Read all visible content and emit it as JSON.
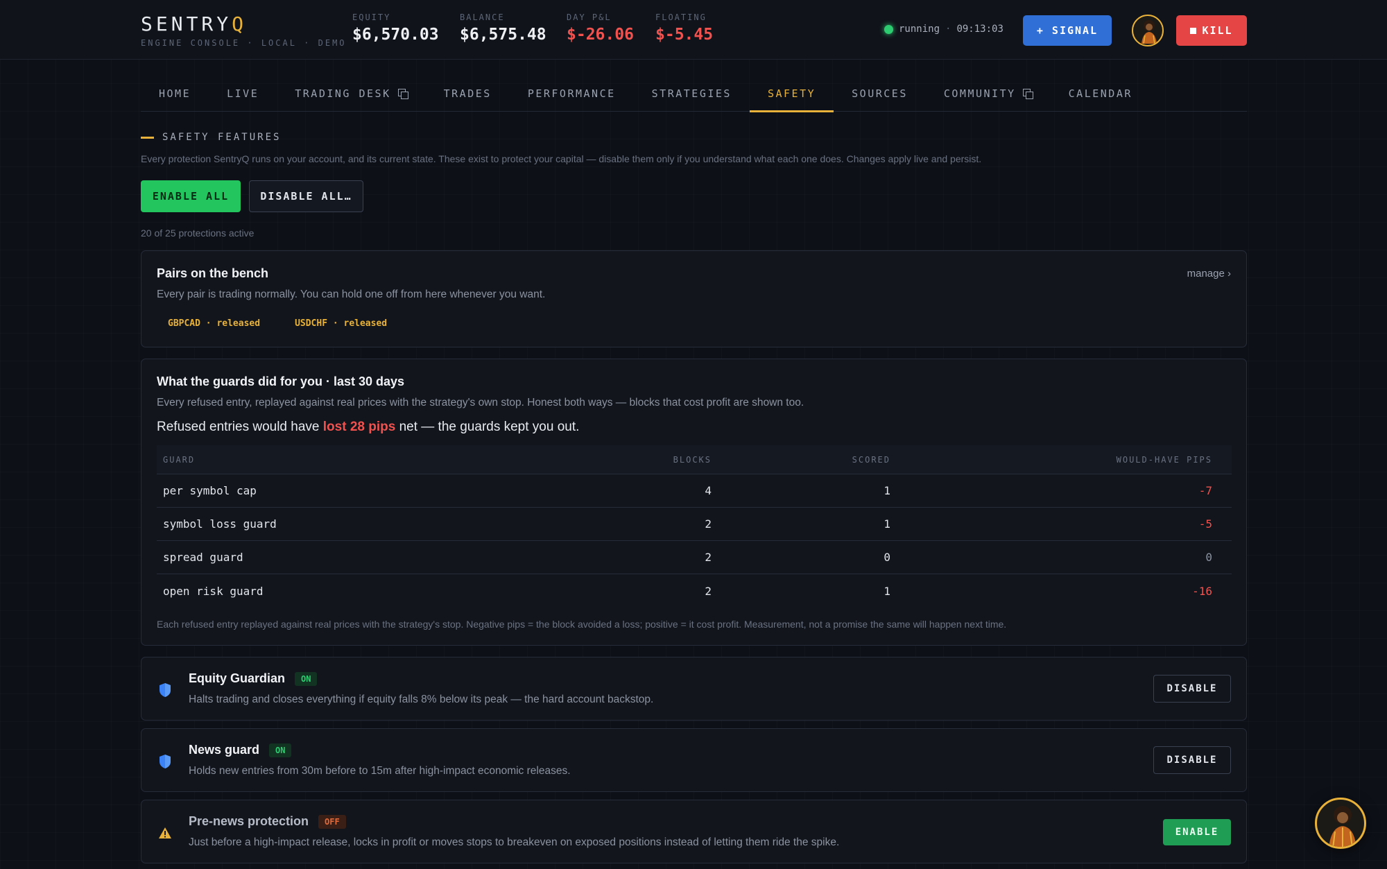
{
  "brand": {
    "name_main": "SENTRY",
    "name_accent": "Q",
    "subtitle": "ENGINE CONSOLE · LOCAL · DEMO"
  },
  "metrics": [
    {
      "label": "EQUITY",
      "value": "$6,570.03",
      "negative": false
    },
    {
      "label": "BALANCE",
      "value": "$6,575.48",
      "negative": false
    },
    {
      "label": "DAY P&L",
      "value": "$-26.06",
      "negative": true
    },
    {
      "label": "FLOATING",
      "value": "$-5.45",
      "negative": true
    }
  ],
  "status": {
    "state": "running",
    "separator": "·",
    "time": "09:13:03"
  },
  "buttons": {
    "signal": "+ SIGNAL",
    "kill": "KILL"
  },
  "nav": {
    "tabs": [
      {
        "label": "HOME"
      },
      {
        "label": "LIVE"
      },
      {
        "label": "TRADING DESK"
      },
      {
        "label": "TRADES"
      },
      {
        "label": "PERFORMANCE"
      },
      {
        "label": "STRATEGIES"
      },
      {
        "label": "SAFETY"
      },
      {
        "label": "SOURCES"
      },
      {
        "label": "COMMUNITY"
      },
      {
        "label": "CALENDAR"
      }
    ],
    "active": "SAFETY",
    "external": [
      "TRADING DESK",
      "COMMUNITY"
    ]
  },
  "safety": {
    "title": "SAFETY FEATURES",
    "description": "Every protection SentryQ runs on your account, and its current state. These exist to protect your capital — disable them only if you understand what each one does. Changes apply live and persist.",
    "enable_all": "ENABLE ALL",
    "disable_all": "DISABLE ALL…",
    "active_count": "20 of 25 protections active"
  },
  "bench": {
    "title": "Pairs on the bench",
    "subtitle": "Every pair is trading normally. You can hold one off from here whenever you want.",
    "manage": "manage ›",
    "chips": [
      "GBPCAD · released",
      "USDCHF · released"
    ]
  },
  "guards": {
    "title": "What the guards did for you · last 30 days",
    "subtitle": "Every refused entry, replayed against real prices with the strategy's own stop. Honest both ways — blocks that cost profit are shown too.",
    "summary_pre": "Refused entries would have ",
    "summary_hl": "lost 28 pips",
    "summary_post": " net — the guards kept you out.",
    "columns": [
      "GUARD",
      "BLOCKS",
      "SCORED",
      "WOULD-HAVE PIPS"
    ],
    "rows": [
      {
        "guard": "per symbol cap",
        "blocks": "4",
        "scored": "1",
        "pips": "-7"
      },
      {
        "guard": "symbol loss guard",
        "blocks": "2",
        "scored": "1",
        "pips": "-5"
      },
      {
        "guard": "spread guard",
        "blocks": "2",
        "scored": "0",
        "pips": "0"
      },
      {
        "guard": "open risk guard",
        "blocks": "2",
        "scored": "1",
        "pips": "-16"
      }
    ],
    "footnote": "Each refused entry replayed against real prices with the strategy's stop. Negative pips = the block avoided a loss; positive = it cost profit. Measurement, not a promise the same will happen next time."
  },
  "features": [
    {
      "title": "Equity Guardian",
      "badge": "ON",
      "state": "on",
      "icon": "shield-icon",
      "desc": "Halts trading and closes everything if equity falls 8% below its peak — the hard account backstop.",
      "action": "DISABLE"
    },
    {
      "title": "News guard",
      "badge": "ON",
      "state": "on",
      "icon": "shield-icon",
      "desc": "Holds new entries from 30m before to 15m after high-impact economic releases.",
      "action": "DISABLE"
    },
    {
      "title": "Pre-news protection",
      "badge": "OFF",
      "state": "off",
      "icon": "warning-icon",
      "desc": "Just before a high-impact release, locks in profit or moves stops to breakeven on exposed positions instead of letting them ride the spike.",
      "action": "ENABLE"
    }
  ],
  "colors": {
    "accent": "#e8b23a",
    "negative": "#f0524f",
    "positive": "#22c55e",
    "signal": "#2f6fd6",
    "kill": "#e54545"
  }
}
